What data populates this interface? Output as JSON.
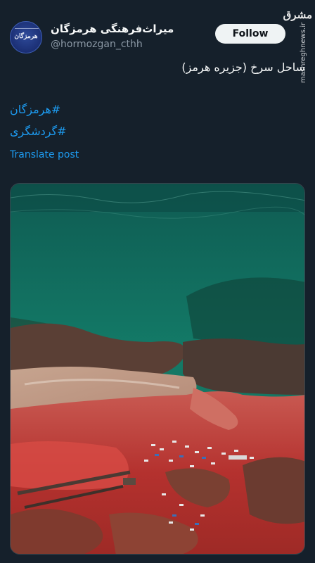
{
  "account": {
    "display_name": "میراث‌فرهنگی هرمزگان",
    "handle": "@hormozgan_cthh",
    "avatar_text": "هرمزگان"
  },
  "follow_label": "Follow",
  "tweet": {
    "text": "ساحل سرخ (جزیره هرمز)",
    "hashtags": [
      "#هرمزگان",
      "#گردشگری"
    ],
    "translate_label": "Translate post"
  },
  "watermark": {
    "logo": "مشرق",
    "url": "mashreghnews.ir"
  },
  "media": {
    "description_icon": "aerial-photo-red-beach"
  },
  "colors": {
    "background": "#15202b",
    "link": "#1d9bf0",
    "text": "#f7f9f9",
    "muted": "#8b98a5"
  }
}
